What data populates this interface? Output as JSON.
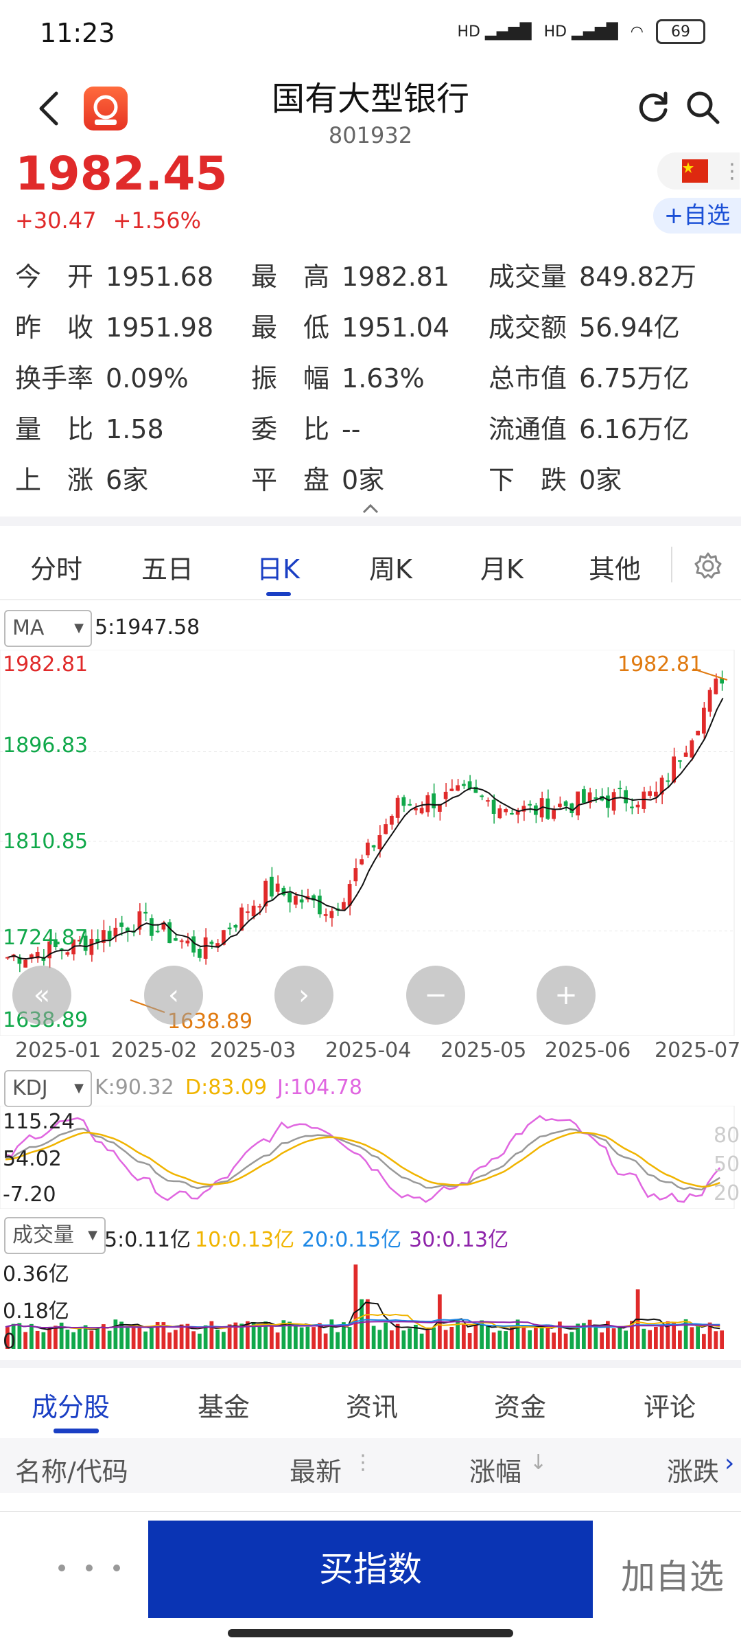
{
  "status": {
    "time": "11:23",
    "battery": "69",
    "network": "HD"
  },
  "header": {
    "title": "国有大型银行",
    "code": "801932"
  },
  "price": {
    "last": "1982.45",
    "change": "+30.47",
    "change_pct": "+1.56%",
    "fav_label": "+自选"
  },
  "stats": [
    [
      {
        "label": "今　开",
        "value": "1951.68"
      },
      {
        "label": "最　高",
        "value": "1982.81"
      },
      {
        "label": "成交量",
        "value": "849.82万"
      }
    ],
    [
      {
        "label": "昨　收",
        "value": "1951.98"
      },
      {
        "label": "最　低",
        "value": "1951.04"
      },
      {
        "label": "成交额",
        "value": "56.94亿"
      }
    ],
    [
      {
        "label": "换手率",
        "value": "0.09%"
      },
      {
        "label": "振　幅",
        "value": "1.63%"
      },
      {
        "label": "总市值",
        "value": "6.75万亿"
      }
    ],
    [
      {
        "label": "量　比",
        "value": "1.58"
      },
      {
        "label": "委　比",
        "value": "--"
      },
      {
        "label": "流通值",
        "value": "6.16万亿"
      }
    ],
    [
      {
        "label": "上　涨",
        "value": "6家"
      },
      {
        "label": "平　盘",
        "value": "0家"
      },
      {
        "label": "下　跌",
        "value": "0家"
      }
    ]
  ],
  "tabs": [
    "分时",
    "五日",
    "日K",
    "周K",
    "月K",
    "其他"
  ],
  "active_tab": "日K",
  "ma": {
    "button": "MA",
    "value_label": "5:1947.58"
  },
  "kline": {
    "y_labels": [
      "1982.81",
      "1896.83",
      "1810.85",
      "1724.87",
      "1638.89"
    ],
    "high_marker": "1982.81",
    "low_marker": "1638.89",
    "x_labels": [
      "2025-01",
      "2025-02",
      "2025-03",
      "2025-04",
      "2025-05",
      "2025-06",
      "2025-07"
    ]
  },
  "kdj": {
    "button": "KDJ",
    "k": "K:90.32",
    "d": "D:83.09",
    "j": "J:104.78",
    "y_labels": [
      "115.24",
      "54.02",
      "-7.20"
    ],
    "right_labels": [
      "80",
      "50",
      "20"
    ]
  },
  "volume": {
    "button": "成交量",
    "ma5": "5:0.11亿",
    "ma10": "10:0.13亿",
    "ma20": "20:0.15亿",
    "ma30": "30:0.13亿",
    "y_labels": [
      "0.36亿",
      "0.18亿",
      "0"
    ]
  },
  "colors": {
    "up": "#e02a2a",
    "down": "#10a84a",
    "accent": "#1a3fc4",
    "k_line": "#999999",
    "d_line": "#f0b400",
    "j_line": "#e066e0",
    "ma20": "#1e88e5",
    "ma30": "#8e24aa"
  },
  "bottom_tabs": [
    "成分股",
    "基金",
    "资讯",
    "资金",
    "评论"
  ],
  "table_headers": {
    "name": "名称/代码",
    "latest": "最新",
    "change_pct": "涨幅",
    "change": "涨跌"
  },
  "actions": {
    "buy": "买指数",
    "add_fav": "加自选"
  },
  "chart_data": {
    "type": "candlestick",
    "x": [
      "2025-01",
      "2025-02",
      "2025-03",
      "2025-04",
      "2025-05",
      "2025-06",
      "2025-07"
    ],
    "ylim": [
      1638.89,
      1982.81
    ],
    "close_approx": [
      1700,
      1710,
      1735,
      1705,
      1765,
      1745,
      1845,
      1855,
      1840,
      1850,
      1855,
      1970
    ],
    "high": 1982.81,
    "low": 1638.89
  }
}
